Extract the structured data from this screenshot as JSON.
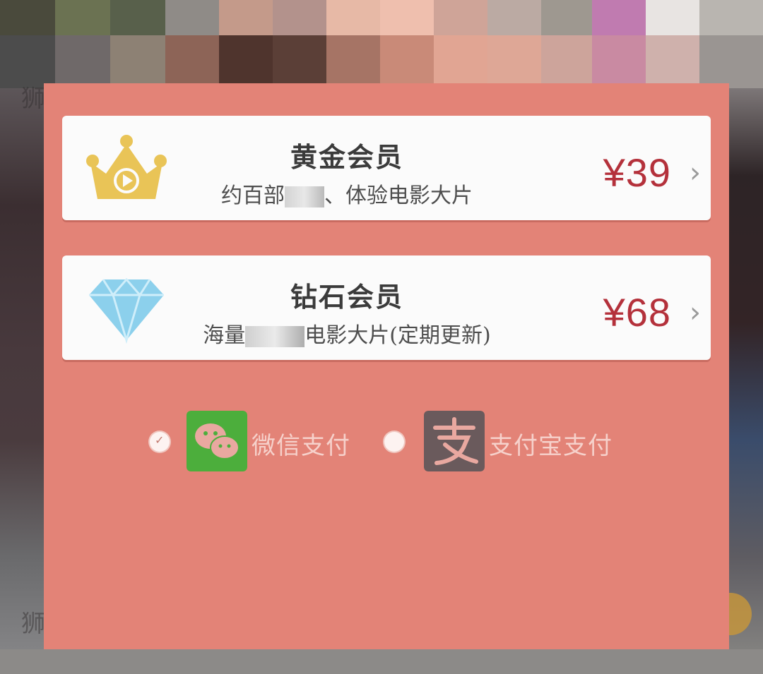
{
  "plans": [
    {
      "name": "黄金会员",
      "description_start": "约百部",
      "description_end": "、体验电影大片",
      "price": "¥39",
      "icon": "crown-play-icon"
    },
    {
      "name": "钻石会员",
      "description_start": "海量",
      "description_end": "电影大片(定期更新)",
      "price": "¥68",
      "icon": "diamond-icon"
    }
  ],
  "chevron": "›",
  "payment": {
    "selected": "wechat",
    "wechat": {
      "label": "微信支付",
      "icon": "wechat-pay-icon",
      "color": "#4cae3c"
    },
    "alipay": {
      "label": "支付宝支付",
      "icon": "alipay-icon",
      "color": "#6a5a5c"
    }
  },
  "colors": {
    "modal_bg": "#e38377",
    "price": "#b4313b",
    "gold": "#e9c457",
    "diamond": "#8cd0ec"
  },
  "background": {
    "visible_char": "狮"
  }
}
